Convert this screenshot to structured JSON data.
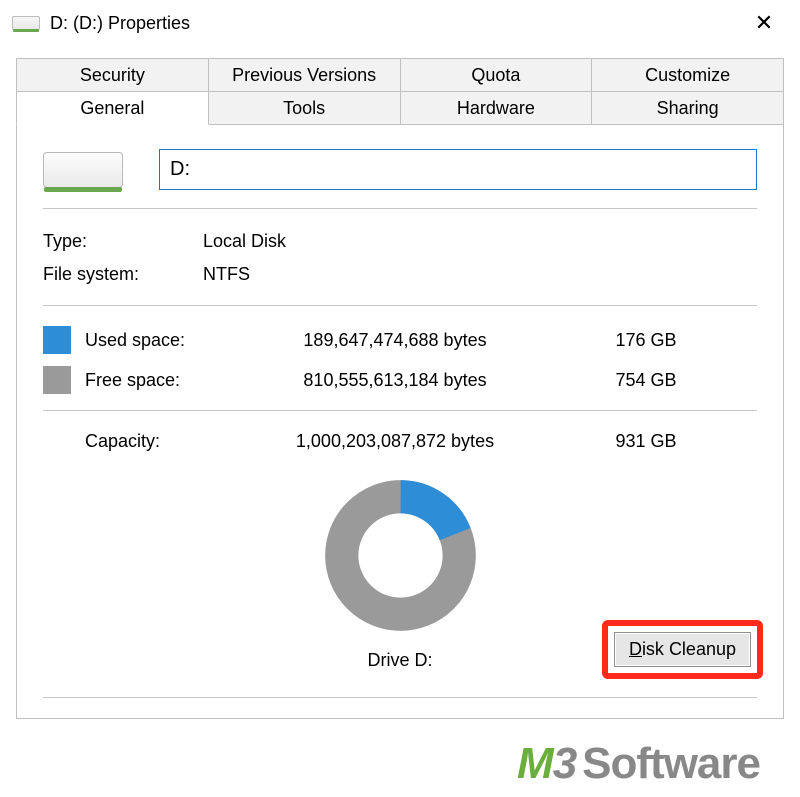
{
  "window": {
    "title": "D: (D:) Properties",
    "close_glyph": "✕"
  },
  "tabs": {
    "top": [
      {
        "id": "security",
        "label": "Security"
      },
      {
        "id": "previous",
        "label": "Previous Versions"
      },
      {
        "id": "quota",
        "label": "Quota"
      },
      {
        "id": "customize",
        "label": "Customize"
      }
    ],
    "bottom": [
      {
        "id": "general",
        "label": "General",
        "active": true
      },
      {
        "id": "tools",
        "label": "Tools"
      },
      {
        "id": "hardware",
        "label": "Hardware"
      },
      {
        "id": "sharing",
        "label": "Sharing"
      }
    ]
  },
  "general": {
    "name_value": "D:",
    "type_label": "Type:",
    "type_value": "Local Disk",
    "fs_label": "File system:",
    "fs_value": "NTFS",
    "used_label": "Used space:",
    "used_bytes": "189,647,474,688 bytes",
    "used_human": "176 GB",
    "free_label": "Free space:",
    "free_bytes": "810,555,613,184 bytes",
    "free_human": "754 GB",
    "capacity_label": "Capacity:",
    "capacity_bytes": "1,000,203,087,872 bytes",
    "capacity_human": "931 GB",
    "drive_label": "Drive D:",
    "cleanup_prefix": "D",
    "cleanup_rest": "isk Cleanup"
  },
  "chart_data": {
    "type": "pie",
    "title": "Drive D:",
    "categories": [
      "Used space",
      "Free space"
    ],
    "values": [
      189647474688,
      810555613184
    ],
    "human": [
      "176 GB",
      "754 GB"
    ],
    "total_bytes": 1000203087872,
    "total_human": "931 GB",
    "colors": {
      "used": "#2d8dd6",
      "free": "#9a9a9a"
    }
  },
  "watermark": {
    "m": "M",
    "three": "3",
    "soft": "Software"
  }
}
